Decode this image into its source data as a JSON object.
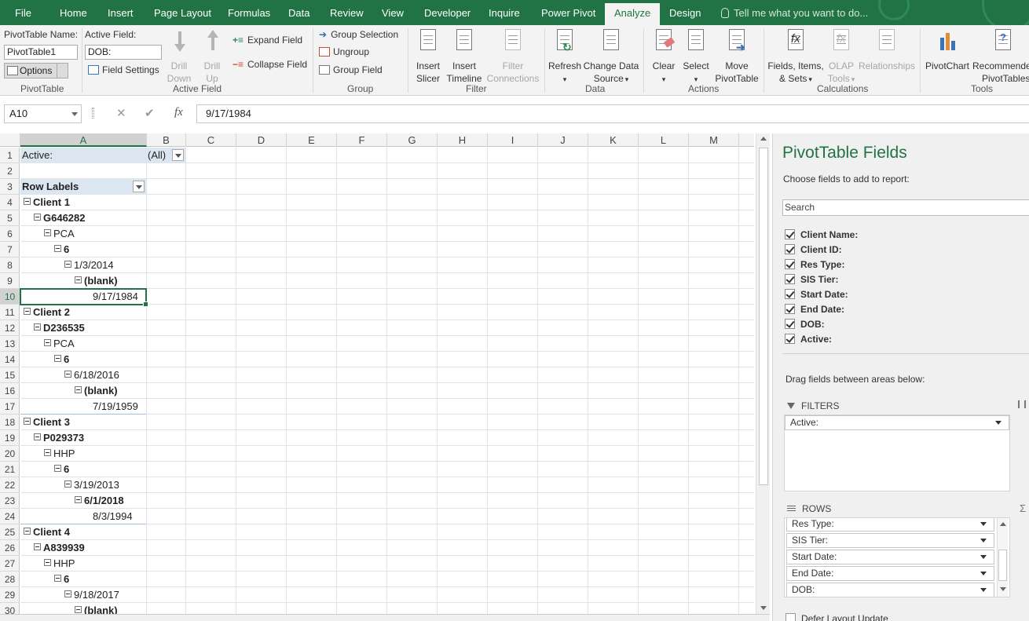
{
  "tabs": [
    "File",
    "Home",
    "Insert",
    "Page Layout",
    "Formulas",
    "Data",
    "Review",
    "View",
    "Developer",
    "Inquire",
    "Power Pivot",
    "Analyze",
    "Design"
  ],
  "tell_me": "Tell me what you want to do...",
  "ribbon": {
    "pivottable_name_label": "PivotTable Name:",
    "pivottable_name_value": "PivotTable1",
    "options_label": "Options",
    "group_pivottable": "PivotTable",
    "active_field_label": "Active Field:",
    "active_field_value": "DOB:",
    "field_settings": "Field Settings",
    "drill_down": [
      "Drill",
      "Down"
    ],
    "drill_up": [
      "Drill",
      "Up"
    ],
    "expand_field": "Expand Field",
    "collapse_field": "Collapse Field",
    "group_active_field": "Active Field",
    "group_selection": "Group Selection",
    "ungroup": "Ungroup",
    "group_field": "Group Field",
    "group_group": "Group",
    "insert_slicer": [
      "Insert",
      "Slicer"
    ],
    "insert_timeline": [
      "Insert",
      "Timeline"
    ],
    "filter_connections": [
      "Filter",
      "Connections"
    ],
    "group_filter": "Filter",
    "refresh": "Refresh",
    "change_data_source": [
      "Change Data",
      "Source"
    ],
    "group_data": "Data",
    "clear": "Clear",
    "select": "Select",
    "move_pivottable": [
      "Move",
      "PivotTable"
    ],
    "group_actions": "Actions",
    "fields_items_sets": [
      "Fields, Items,",
      "& Sets"
    ],
    "olap_tools": [
      "OLAP",
      "Tools"
    ],
    "relationships": "Relationships",
    "group_calculations": "Calculations",
    "pivotchart": "PivotChart",
    "recommended_pivottables": [
      "Recommended",
      "PivotTables"
    ],
    "group_tools": "Tools"
  },
  "formula_bar": {
    "name_box": "A10",
    "value": "9/17/1984"
  },
  "columns": [
    "A",
    "B",
    "C",
    "D",
    "E",
    "F",
    "G",
    "H",
    "I",
    "J",
    "K",
    "L",
    "M"
  ],
  "rows": [
    "1",
    "2",
    "3",
    "4",
    "5",
    "6",
    "7",
    "8",
    "9",
    "10",
    "11",
    "12",
    "13",
    "14",
    "15",
    "16",
    "17",
    "18",
    "19",
    "20",
    "21",
    "22",
    "23",
    "24",
    "25",
    "26",
    "27",
    "28",
    "29",
    "30"
  ],
  "cells": {
    "r1a": "Active:",
    "r1b": "(All)",
    "r3a": "Row Labels",
    "r4": "Client 1",
    "r5": "G646282",
    "r6": "PCA",
    "r7": "6",
    "r8": "1/3/2014",
    "r9": "(blank)",
    "r10": "9/17/1984",
    "r11": "Client 2",
    "r12": "D236535",
    "r13": "PCA",
    "r14": "6",
    "r15": "6/18/2016",
    "r16": "(blank)",
    "r17": "7/19/1959",
    "r18": "Client 3",
    "r19": "P029373",
    "r20": "HHP",
    "r21": "6",
    "r22": "3/19/2013",
    "r23": "6/1/2018",
    "r24": "8/3/1994",
    "r25": "Client 4",
    "r26": "A839939",
    "r27": "HHP",
    "r28": "6",
    "r29": "9/18/2017",
    "r30": "(blank)"
  },
  "pane": {
    "title": "PivotTable Fields",
    "subtitle": "Choose fields to add to report:",
    "search_placeholder": "Search",
    "fields": [
      "Client Name:",
      "Client ID:",
      "Res Type:",
      "SIS Tier:",
      "Start Date:",
      "End Date:",
      "DOB:",
      "Active:"
    ],
    "drag_label": "Drag fields between areas below:",
    "filters_label": "FILTERS",
    "filters_items": [
      "Active:"
    ],
    "rows_label": "ROWS",
    "rows_items": [
      "Res Type:",
      "SIS Tier:",
      "Start Date:",
      "End Date:",
      "DOB:"
    ],
    "defer_label": "Defer Layout Update"
  },
  "colors": {
    "accent": "#217346",
    "row_label_band": "#dce6f1"
  }
}
